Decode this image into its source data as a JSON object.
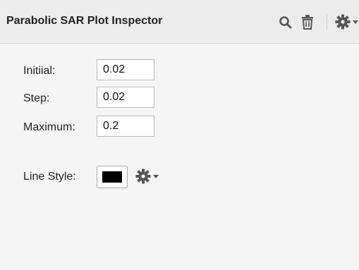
{
  "inspector": {
    "title": "Parabolic SAR Plot Inspector",
    "toolbar_icons": [
      "search-icon",
      "trash-icon",
      "gear-icon",
      "chevron-down-icon"
    ]
  },
  "fields": {
    "initial": {
      "label": "Initiial:",
      "value": "0.02"
    },
    "step": {
      "label": "Step:",
      "value": "0.02"
    },
    "maximum": {
      "label": "Maximum:",
      "value": "0.2"
    }
  },
  "line_style": {
    "label": "Line Style:",
    "color": "#000000",
    "action_icons": [
      "gear-icon",
      "chevron-down-icon"
    ]
  },
  "colors": {
    "titlebar": "#ececec",
    "panel": "#f5f5f5",
    "icon": "#555555"
  }
}
